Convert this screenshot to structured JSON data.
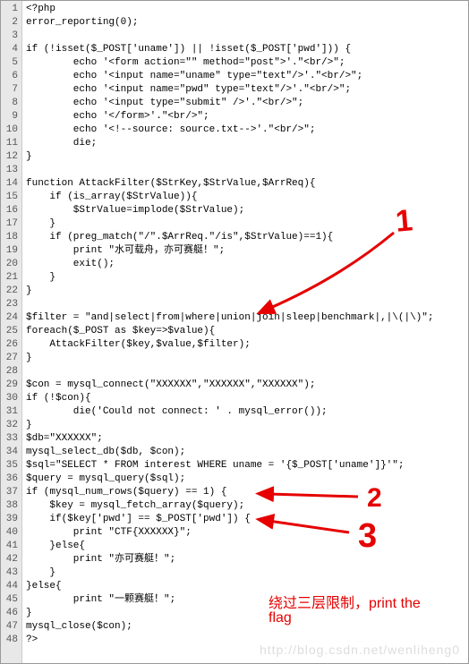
{
  "lines": [
    "<?php",
    "error_reporting(0);",
    "",
    "if (!isset($_POST['uname']) || !isset($_POST['pwd'])) {",
    "        echo '<form action=\"\" method=\"post\">'.\"<br/>\";",
    "        echo '<input name=\"uname\" type=\"text\"/>'.\"<br/>\";",
    "        echo '<input name=\"pwd\" type=\"text\"/>'.\"<br/>\";",
    "        echo '<input type=\"submit\" />'.\"<br/>\";",
    "        echo '</form>'.\"<br/>\";",
    "        echo '<!--source: source.txt-->'.\"<br/>\";",
    "        die;",
    "}",
    "",
    "function AttackFilter($StrKey,$StrValue,$ArrReq){",
    "    if (is_array($StrValue)){",
    "        $StrValue=implode($StrValue);",
    "    }",
    "    if (preg_match(\"/\".$ArrReq.\"/is\",$StrValue)==1){",
    "        print \"水可载舟，亦可赛艇！\";",
    "        exit();",
    "    }",
    "}",
    "",
    "$filter = \"and|select|from|where|union|join|sleep|benchmark|,|\\(|\\)\";",
    "foreach($_POST as $key=>$value){",
    "    AttackFilter($key,$value,$filter);",
    "}",
    "",
    "$con = mysql_connect(\"XXXXXX\",\"XXXXXX\",\"XXXXXX\");",
    "if (!$con){",
    "        die('Could not connect: ' . mysql_error());",
    "}",
    "$db=\"XXXXXX\";",
    "mysql_select_db($db, $con);",
    "$sql=\"SELECT * FROM interest WHERE uname = '{$_POST['uname']}'\";",
    "$query = mysql_query($sql);",
    "if (mysql_num_rows($query) == 1) {",
    "    $key = mysql_fetch_array($query);",
    "    if($key['pwd'] == $_POST['pwd']) {",
    "        print \"CTF{XXXXXX}\";",
    "    }else{",
    "        print \"亦可赛艇！\";",
    "    }",
    "}else{",
    "        print \"一颗赛艇！\";",
    "}",
    "mysql_close($con);",
    "?>"
  ],
  "annotations": {
    "num1": "1",
    "num2": "2",
    "num3": "3",
    "comment_line1": "绕过三层限制，print the",
    "comment_line2": "flag"
  },
  "watermark": "http://blog.csdn.net/wenliheng0"
}
